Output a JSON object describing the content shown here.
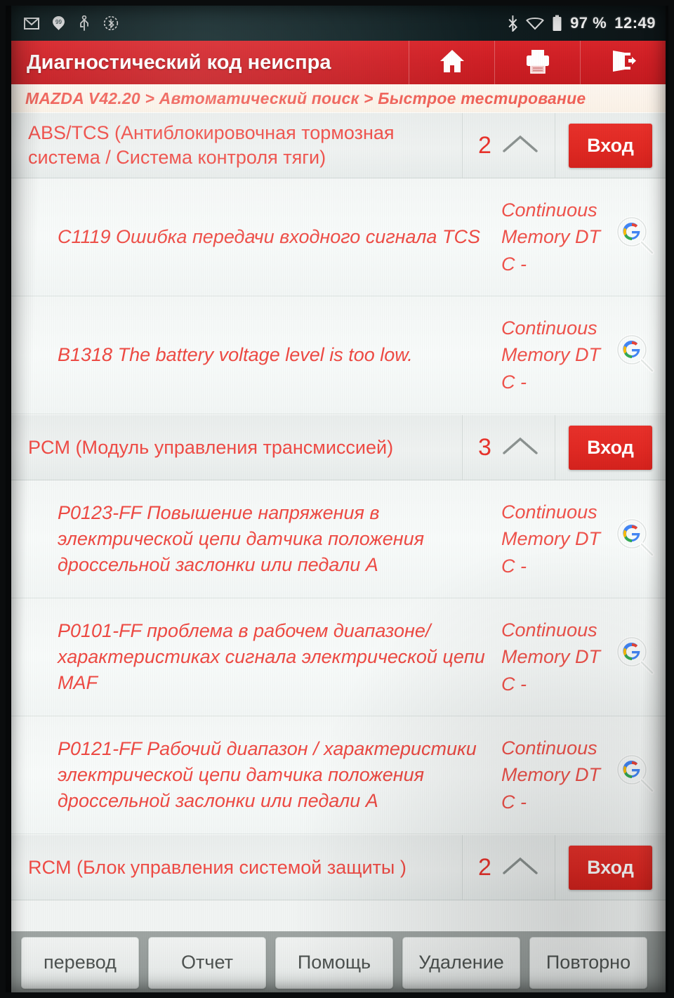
{
  "status_bar": {
    "left_icons": [
      "gmail-icon",
      "hangouts-icon",
      "usb-icon",
      "bluetooth-settings-icon"
    ],
    "right_icons": [
      "bluetooth-icon",
      "wifi-icon",
      "battery-icon"
    ],
    "battery_percent": "97 %",
    "clock": "12:49"
  },
  "header": {
    "title": "Диагностический код неиспра",
    "actions": [
      {
        "name": "home-icon",
        "label": "home"
      },
      {
        "name": "print-icon",
        "label": "print"
      },
      {
        "name": "exit-icon",
        "label": "exit"
      }
    ]
  },
  "breadcrumb": {
    "text": "MAZDA V42.20 > Автоматический поиск > Быстрое тестирование"
  },
  "colors": {
    "brand_red": "#cf1f25",
    "accent_red": "#e8312b",
    "text_red": "#ee4a43",
    "breadcrumb_red": "#f06158",
    "toolbar_grey": "#9fa5a3"
  },
  "list": {
    "enter_label": "Вход",
    "collapse_icon": "chevron-up-icon",
    "search_icon": "google-search-icon",
    "sections": [
      {
        "name": "ABS/TCS (Антиблокировочная тормозная система / Система контроля тяги)",
        "count": "2",
        "codes": [
          {
            "text": "C1119 Ошибка передачи входного сигнала TCS",
            "status": "Continuous Memory DTC -"
          },
          {
            "text": "B1318 The battery voltage level is too low.",
            "status": "Continuous Memory DTC -"
          }
        ]
      },
      {
        "name": "PCM (Модуль управления трансмиссией)",
        "count": "3",
        "codes": [
          {
            "text": "P0123-FF Повышение напряжения в электрической цепи датчика положения дроссельной заслонки или педали A",
            "status": "Continuous Memory DTC -"
          },
          {
            "text": "P0101-FF проблема в рабочем диапазоне/характеристиках сигнала электрической цепи MAF",
            "status": "Continuous Memory DTC -"
          },
          {
            "text": "P0121-FF Рабочий диапазон / характеристики электрической цепи датчика положения дроссельной заслонки или педали A",
            "status": "Continuous Memory DTC -"
          }
        ]
      },
      {
        "name": "RCM (Блок управления системой защиты )",
        "count": "2",
        "codes": []
      }
    ]
  },
  "toolbar": {
    "buttons": [
      {
        "label": "перевод"
      },
      {
        "label": "Отчет"
      },
      {
        "label": "Помощь"
      },
      {
        "label": "Удаление"
      },
      {
        "label": "Повторно"
      }
    ]
  }
}
